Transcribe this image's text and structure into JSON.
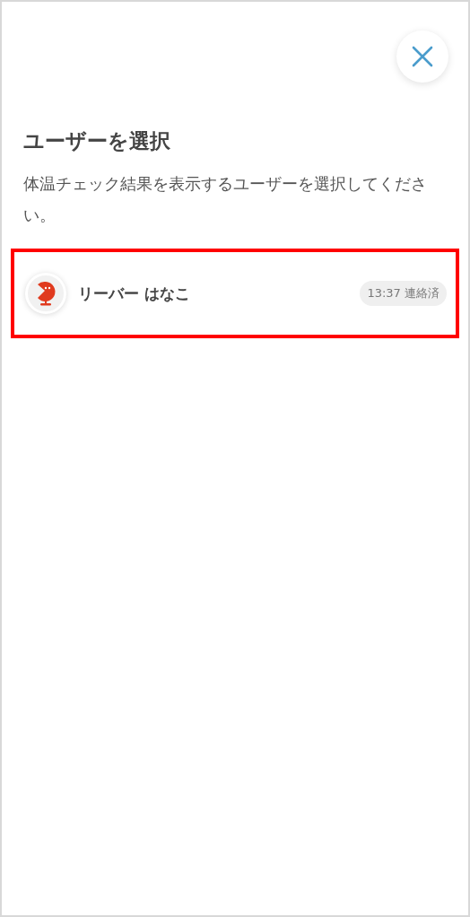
{
  "title": "ユーザーを選択",
  "description": "体温チェック結果を表示するユーザーを選択してください。",
  "users": [
    {
      "name": "リーバー はなこ",
      "status": "13:37 連絡済",
      "highlighted": true
    }
  ]
}
